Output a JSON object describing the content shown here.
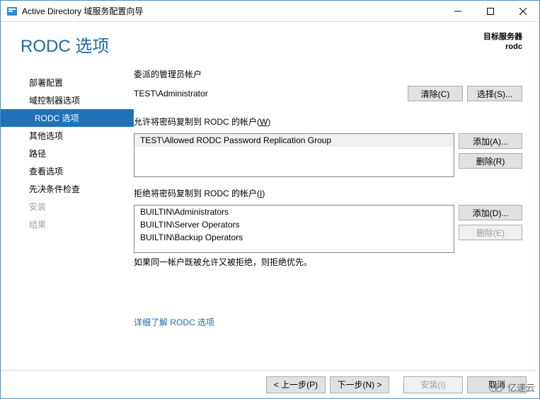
{
  "titlebar": {
    "title": "Active Directory 域服务配置向导"
  },
  "header": {
    "page_title": "RODC 选项",
    "target_label": "目标服务器",
    "target_value": "rodc"
  },
  "sidebar": {
    "items": [
      {
        "label": "部署配置",
        "state": "normal"
      },
      {
        "label": "域控制器选项",
        "state": "normal"
      },
      {
        "label": "RODC 选项",
        "state": "active"
      },
      {
        "label": "其他选项",
        "state": "normal"
      },
      {
        "label": "路径",
        "state": "normal"
      },
      {
        "label": "查看选项",
        "state": "normal"
      },
      {
        "label": "先决条件检查",
        "state": "normal"
      },
      {
        "label": "安装",
        "state": "disabled"
      },
      {
        "label": "结果",
        "state": "disabled"
      }
    ]
  },
  "content": {
    "delegated_label": "委派的管理员帐户",
    "delegated_value": "TEST\\Administrator",
    "clear_btn": "清除(C)",
    "select_btn": "选择(S)...",
    "allow_label_pre": "允许将密码复制到 RODC 的帐户(",
    "allow_label_accel": "W",
    "allow_label_post": ")",
    "allow_items": [
      "TEST\\Allowed RODC Password Replication Group"
    ],
    "add_a_btn": "添加(A)...",
    "remove_r_btn": "删除(R)",
    "deny_label_pre": "拒绝将密码复制到 RODC 的帐户(",
    "deny_label_accel": "I",
    "deny_label_post": ")",
    "deny_items": [
      "BUILTIN\\Administrators",
      "BUILTIN\\Server Operators",
      "BUILTIN\\Backup Operators"
    ],
    "add_d_btn": "添加(D)...",
    "remove_e_btn": "删除(E)",
    "note": "如果同一帐户既被允许又被拒绝，则拒绝优先。",
    "link": "详细了解 RODC 选项"
  },
  "footer": {
    "prev": "< 上一步(P)",
    "next": "下一步(N) >",
    "install": "安装(I)",
    "cancel": "取消"
  },
  "watermark": {
    "text": "亿速云"
  }
}
